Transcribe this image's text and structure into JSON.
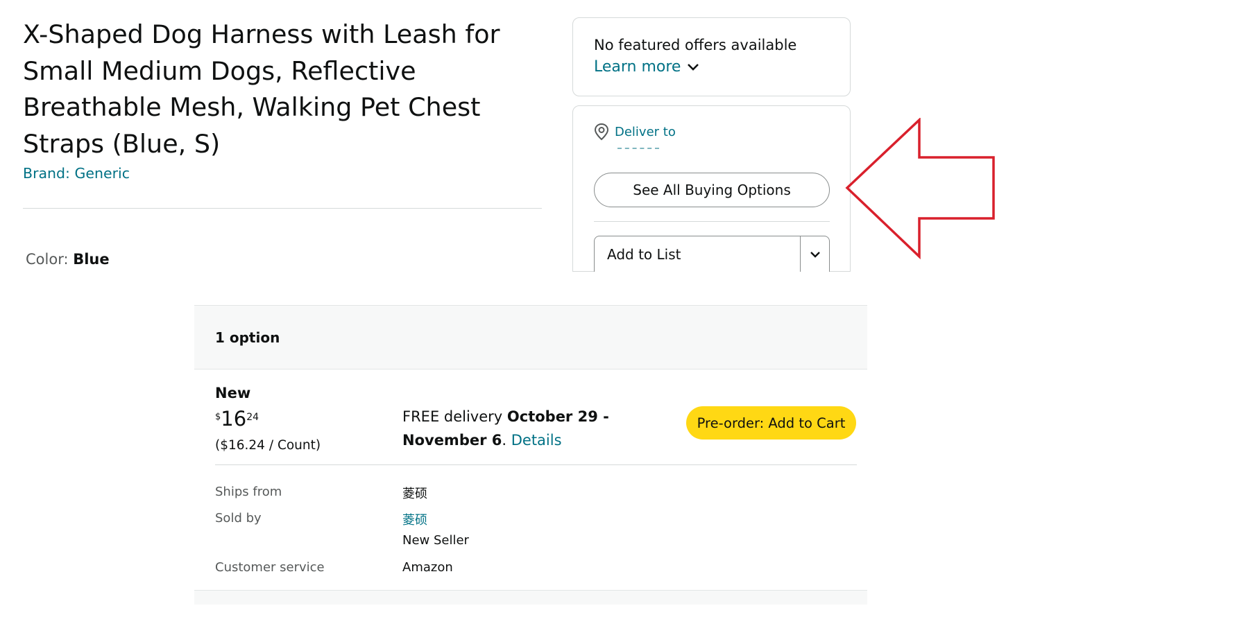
{
  "product": {
    "title": "X-Shaped Dog Harness with Leash for Small Medium Dogs, Reflective Breathable Mesh, Walking Pet Chest Straps (Blue, S)",
    "brand": "Brand: Generic",
    "color_label": "Color: ",
    "color_value": "Blue"
  },
  "offers_box": {
    "message": "No featured offers available",
    "learn_more": "Learn more"
  },
  "buy_box": {
    "deliver_to": "Deliver to",
    "see_all_button": "See All Buying Options",
    "add_to_list": "Add to List"
  },
  "options": {
    "count": "1 option",
    "condition": "New",
    "price_symbol": "$",
    "price_whole": "16",
    "price_fraction": "24",
    "unit_price": "($16.24 / Count)",
    "delivery_prefix": "FREE delivery ",
    "delivery_dates": "October 29 - November 6",
    "delivery_sep": ". ",
    "details_link": "Details",
    "preorder_button": "Pre-order: Add to Cart",
    "ships_from_label": "Ships from",
    "ships_from_value": "菱硕",
    "sold_by_label": "Sold by",
    "sold_by_value": "菱硕",
    "seller_note": "New Seller",
    "customer_service_label": "Customer service",
    "customer_service_value": "Amazon"
  },
  "colors": {
    "link": "#007185",
    "button_yellow": "#ffd814",
    "arrow_red": "#d9202c",
    "header_bg": "#f7f8f8"
  },
  "icons": {
    "location": "location-pin-icon",
    "chevron": "chevron-down-icon",
    "annotation": "red-arrow-left-icon"
  }
}
